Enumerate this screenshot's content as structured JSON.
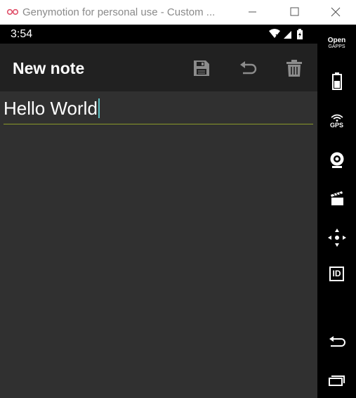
{
  "window": {
    "title": "Genymotion for personal use - Custom ...",
    "logo_icon": "genymotion-logo-icon",
    "controls": [
      "minimize-icon",
      "maximize-icon",
      "close-icon"
    ]
  },
  "status_bar": {
    "time": "3:54",
    "icons": [
      "wifi-icon",
      "signal-icon",
      "battery-charging-icon"
    ]
  },
  "app_bar": {
    "title": "New note",
    "actions": [
      {
        "icon": "save-icon"
      },
      {
        "icon": "undo-icon"
      },
      {
        "icon": "delete-icon"
      }
    ]
  },
  "editor": {
    "text": "Hello World",
    "accent_color": "#8a9a2a",
    "caret_color": "#5fc5c8"
  },
  "sidebar": {
    "open_gapps_line1": "Open",
    "open_gapps_line2": "GAPPS",
    "gps_label": "GPS",
    "id_label": "ID",
    "icons": [
      "open-gapps-icon",
      "battery-icon",
      "gps-icon",
      "webcam-icon",
      "media-icon",
      "dpad-icon",
      "device-id-icon",
      "back-icon",
      "recent-apps-icon"
    ]
  },
  "colors": {
    "screen_bg": "#303030",
    "appbar_bg": "#212121",
    "statusbar_bg": "#000000",
    "sidebar_bg": "#000000"
  }
}
